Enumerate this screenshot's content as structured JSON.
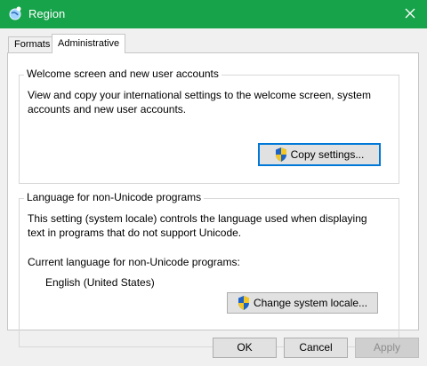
{
  "window": {
    "title": "Region"
  },
  "tabs": [
    {
      "label": "Formats"
    },
    {
      "label": "Administrative"
    }
  ],
  "welcome": {
    "group_title": "Welcome screen and new user accounts",
    "description_line1": "View and copy your international settings to the welcome screen, system",
    "description_line2": "accounts and new user accounts.",
    "copy_button": "Copy settings..."
  },
  "nonunicode": {
    "group_title": "Language for non-Unicode programs",
    "description_line1": "This setting (system locale) controls the language used when displaying",
    "description_line2": "text in programs that do not support Unicode.",
    "current_label": "Current language for non-Unicode programs:",
    "current_value": "English (United States)",
    "change_button": "Change system locale..."
  },
  "footer": {
    "ok": "OK",
    "cancel": "Cancel",
    "apply": "Apply"
  },
  "colors": {
    "titlebar": "#16a34a",
    "focus": "#0078d7"
  }
}
